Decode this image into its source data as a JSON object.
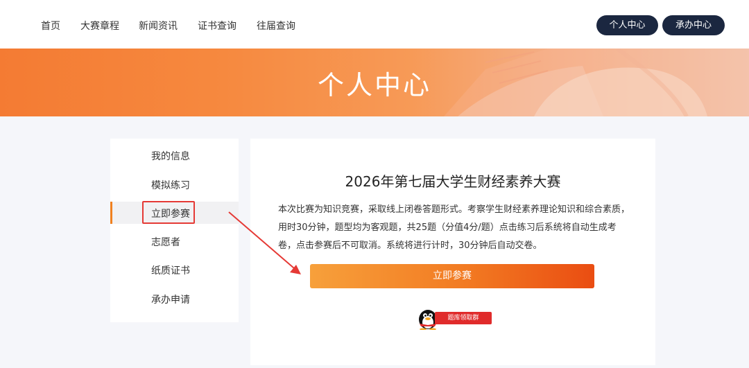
{
  "nav": {
    "links": [
      "首页",
      "大赛章程",
      "新闻资讯",
      "证书查询",
      "往届查询"
    ],
    "personal_center": "个人中心",
    "organizer_center": "承办中心"
  },
  "banner": {
    "title": "个人中心"
  },
  "sidebar": {
    "items": [
      {
        "label": "我的信息"
      },
      {
        "label": "模拟练习"
      },
      {
        "label": "立即参赛"
      },
      {
        "label": "志愿者"
      },
      {
        "label": "纸质证书"
      },
      {
        "label": "承办申请"
      }
    ],
    "active_index": 2
  },
  "contest": {
    "title": "2026年第七届大学生财经素养大赛",
    "description": "本次比赛为知识竞赛，采取线上闭卷答题形式。考察学生财经素养理论知识和综合素质，用时30分钟，题型均为客观题，共25题（分值4分/题）点击练习后系统将自动生成考卷，点击参赛后不可取消。系统将进行计时，30分钟后自动交卷。",
    "join_button": "立即参赛",
    "qq_group_label": "题库领取群"
  },
  "colors": {
    "nav_button_bg": "#1b2740",
    "accent_orange": "#f0811f",
    "highlight_red": "#e53935"
  }
}
